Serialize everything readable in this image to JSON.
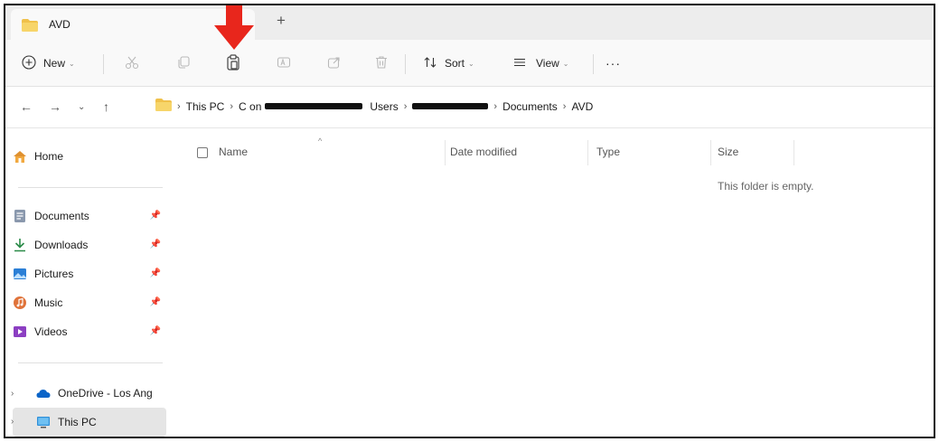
{
  "window": {
    "tab_title": "AVD",
    "new_tab_label": "+"
  },
  "toolbar": {
    "new_label": "New",
    "sort_label": "Sort",
    "view_label": "View",
    "more_label": "···"
  },
  "address": {
    "crumbs": [
      "This PC",
      "C on",
      "Users",
      "Documents",
      "AVD"
    ]
  },
  "sidebar": {
    "home": "Home",
    "items": [
      "Documents",
      "Downloads",
      "Pictures",
      "Music",
      "Videos"
    ],
    "onedrive": "OneDrive - Los Ang",
    "thispc": "This PC"
  },
  "columns": {
    "name": "Name",
    "date_modified": "Date modified",
    "type": "Type",
    "size": "Size"
  },
  "empty_message": "This folder is empty.",
  "colors": {
    "annotation_arrow": "#e8261c",
    "folder_yellow": "#f0c14b",
    "onedrive_blue": "#0a64c8"
  }
}
